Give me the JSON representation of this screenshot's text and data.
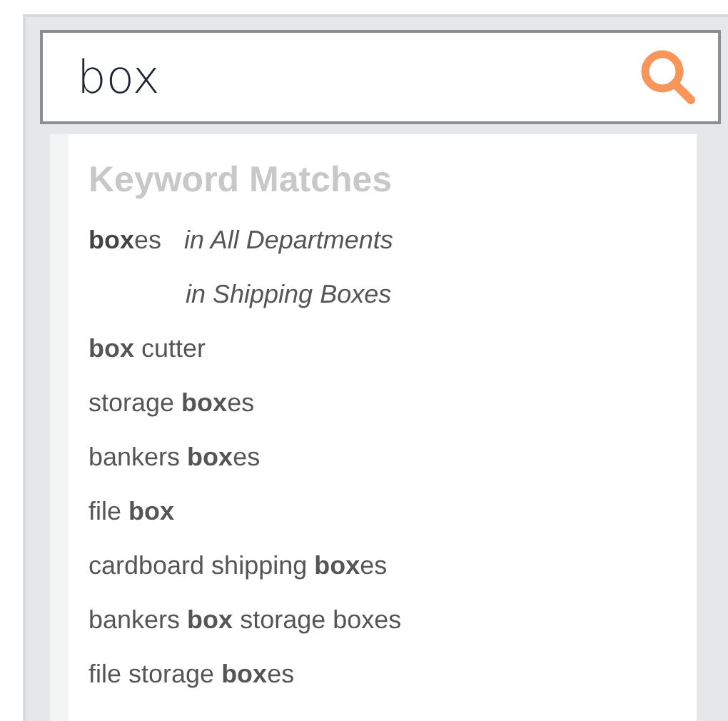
{
  "search": {
    "value": "box"
  },
  "dropdown": {
    "heading": "Keyword Matches",
    "suggestions": [
      {
        "kind": "scoped",
        "text": "**box**es",
        "scope": "in All Departments"
      },
      {
        "kind": "scope",
        "scope": "in Shipping Boxes"
      },
      {
        "kind": "plain",
        "text": "**box** cutter"
      },
      {
        "kind": "plain",
        "text": "storage **box**es"
      },
      {
        "kind": "plain",
        "text": "bankers **box**es"
      },
      {
        "kind": "plain",
        "text": "file **box**"
      },
      {
        "kind": "plain",
        "text": "cardboard shipping **box**es"
      },
      {
        "kind": "plain",
        "text": "bankers **box** storage boxes"
      },
      {
        "kind": "plain",
        "text": "file storage **box**es"
      }
    ]
  }
}
